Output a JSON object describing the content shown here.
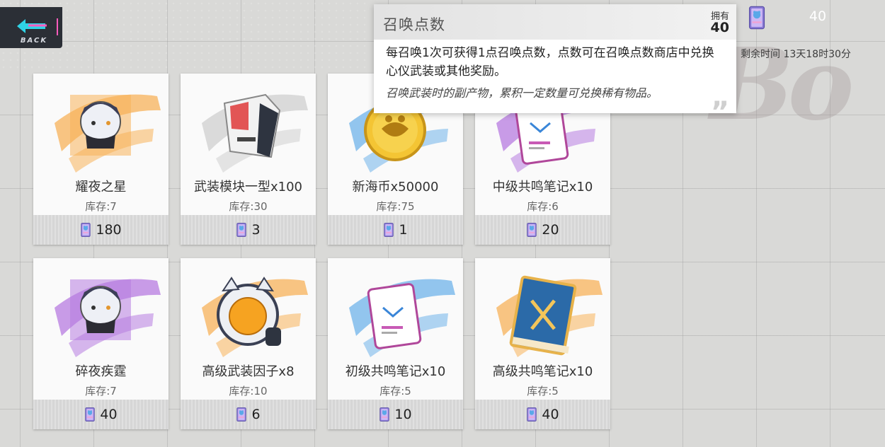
{
  "back": {
    "label": "BACK"
  },
  "currency": {
    "count": "40",
    "timer": "剩余时间 13天18时30分"
  },
  "tooltip": {
    "title": "召唤点数",
    "own_label": "拥有",
    "own_value": "40",
    "desc": "每召唤1次可获得1点召唤点数，点数可在召唤点数商店中兑换心仪武装或其他奖励。",
    "note": "召唤武装时的副产物，累积一定数量可兑换稀有物品。"
  },
  "colors": {
    "accent_cyan": "#2fd3e6",
    "accent_pink": "#ff5bbd",
    "brush_orange": "#f7b25a",
    "brush_blue": "#6fb3ea",
    "brush_purple": "#b77be0"
  },
  "items": [
    {
      "name": "耀夜之星",
      "stock": "库存:7",
      "price": "180",
      "icon": "character-portrait-icon",
      "brush": "#f7b25a"
    },
    {
      "name": "武装模块一型x100",
      "stock": "库存:30",
      "price": "3",
      "icon": "armament-module-icon",
      "brush": "#cfcfcf"
    },
    {
      "name": "新海币x50000",
      "stock": "库存:75",
      "price": "1",
      "icon": "gold-coin-icon",
      "brush": "#6fb3ea"
    },
    {
      "name": "中级共鸣笔记x10",
      "stock": "库存:6",
      "price": "20",
      "icon": "resonance-note-icon",
      "brush": "#b77be0"
    },
    {
      "name": "碎夜疾霆",
      "stock": "库存:7",
      "price": "40",
      "icon": "character-portrait-icon",
      "brush": "#b77be0"
    },
    {
      "name": "高级武装因子x8",
      "stock": "库存:10",
      "price": "6",
      "icon": "armament-factor-icon",
      "brush": "#f7b25a"
    },
    {
      "name": "初级共鸣笔记x10",
      "stock": "库存:5",
      "price": "10",
      "icon": "resonance-note-icon",
      "brush": "#6fb3ea"
    },
    {
      "name": "高级共鸣笔记x10",
      "stock": "库存:5",
      "price": "40",
      "icon": "resonance-book-icon",
      "brush": "#f7b25a"
    }
  ]
}
